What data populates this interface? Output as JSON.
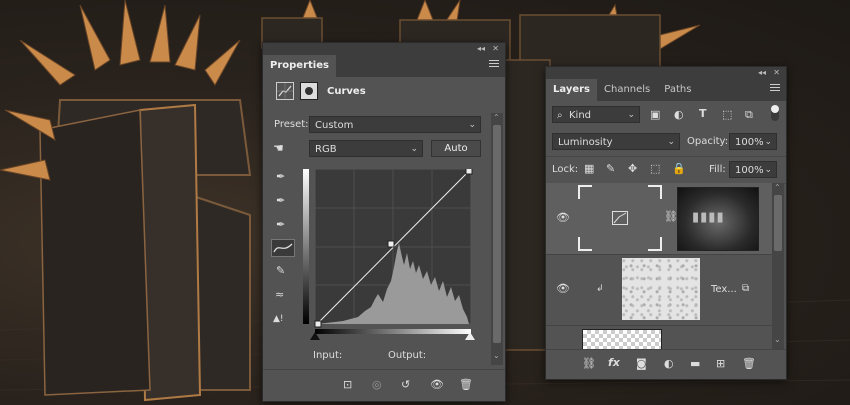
{
  "properties": {
    "title": "Properties",
    "adjustment_name": "Curves",
    "preset_label": "Preset:",
    "preset_value": "Custom",
    "channel_value": "RGB",
    "auto_label": "Auto",
    "input_label": "Input:",
    "output_label": "Output:"
  },
  "layers": {
    "tabs": [
      "Layers",
      "Channels",
      "Paths"
    ],
    "filter_value": "Kind",
    "blend_mode": "Luminosity",
    "opacity_label": "Opacity:",
    "opacity_value": "100%",
    "lock_label": "Lock:",
    "fill_label": "Fill:",
    "fill_value": "100%",
    "layer2_name": "Tex..."
  },
  "colors": {
    "panel_bg": "#535353",
    "panel_header": "#3d3d3d",
    "field_bg": "#3c3c3c",
    "accent_copper": "#c98a4a"
  }
}
